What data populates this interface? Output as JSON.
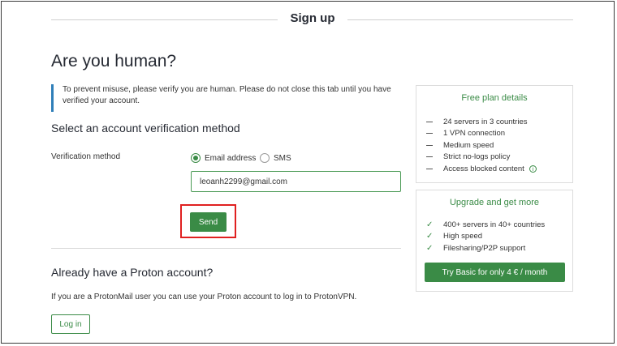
{
  "header": {
    "title": "Sign up"
  },
  "main": {
    "heading": "Are you human?",
    "notice": "To prevent misuse, please verify you are human. Please do not close this tab until you have verified your account.",
    "method_heading": "Select an account verification method",
    "method_label": "Verification method",
    "options": [
      {
        "label": "Email address",
        "selected": true
      },
      {
        "label": "SMS",
        "selected": false
      }
    ],
    "email_value": "leoanh2299@gmail.com",
    "send_label": "Send",
    "existing_heading": "Already have a Proton account?",
    "existing_text": "If you are a ProtonMail user you can use your Proton account to log in to ProtonVPN.",
    "login_label": "Log in"
  },
  "free_plan": {
    "title": "Free plan details",
    "items": [
      "24 servers in 3 countries",
      "1 VPN connection",
      "Medium speed",
      "Strict no-logs policy",
      "Access blocked content"
    ]
  },
  "upgrade": {
    "title": "Upgrade and get more",
    "items": [
      "400+ servers in 40+ countries",
      "High speed",
      "Filesharing/P2P support"
    ],
    "cta_label": "Try Basic for only 4 € / month"
  },
  "colors": {
    "accent": "#3a8b46",
    "notice_border": "#2f7fb9",
    "highlight": "#e02020"
  }
}
